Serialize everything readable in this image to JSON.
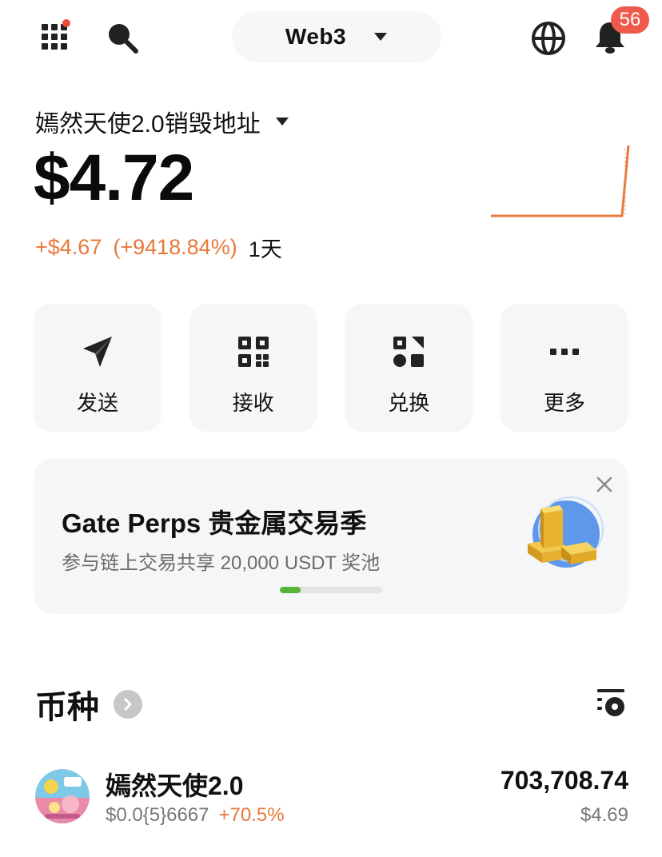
{
  "topbar": {
    "apps_icon": "apps-grid-icon",
    "search_icon": "search-icon",
    "network": {
      "label": "Web3",
      "icon": "caret-down-icon"
    },
    "globe_icon": "globe-icon",
    "bell_icon": "bell-icon",
    "notification_count": "56"
  },
  "wallet": {
    "name": "嫣然天使2.0销毁地址",
    "balance": "$4.72",
    "change_amount": "+$4.67",
    "change_percent": "(+9418.84%)",
    "period": "1天"
  },
  "actions": [
    {
      "label": "发送",
      "icon": "send-icon"
    },
    {
      "label": "接收",
      "icon": "qr-receive-icon"
    },
    {
      "label": "兑换",
      "icon": "swap-icon"
    },
    {
      "label": "更多",
      "icon": "more-icon"
    }
  ],
  "banner": {
    "title": "Gate Perps 贵金属交易季",
    "subtitle": "参与链上交易共享 20,000 USDT 奖池",
    "close_icon": "close-icon",
    "art_icon": "gold-bars-icon",
    "carousel_progress": 0.2
  },
  "tokens": {
    "header": "币种",
    "manage_icon": "token-manage-icon",
    "items": [
      {
        "name": "嫣然天使2.0",
        "price": "$0.0{5}6667",
        "change": "+70.5%",
        "amount": "703,708.74",
        "value": "$4.69"
      }
    ]
  },
  "colors": {
    "accent_orange": "#e8783c",
    "badge_red": "#ef5a4c",
    "tile_bg": "#f5f6f7",
    "progress_green": "#58b33a"
  }
}
